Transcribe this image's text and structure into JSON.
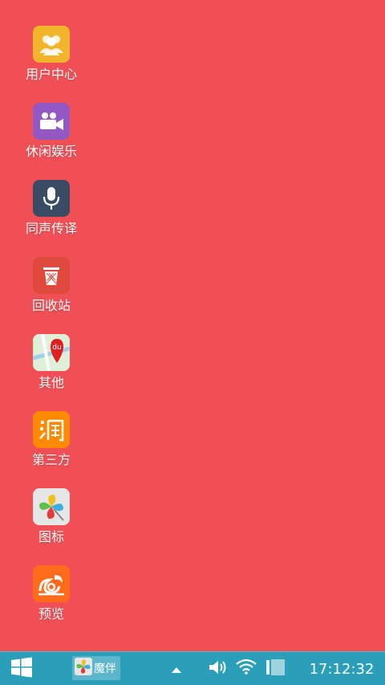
{
  "desktop": {
    "background": "#f05055",
    "icons": [
      {
        "label": "用户中心",
        "icon": "user-group-icon",
        "color": "#f2b42a"
      },
      {
        "label": "休闲娱乐",
        "icon": "video-camera-icon",
        "color": "#9358c2"
      },
      {
        "label": "同声传译",
        "icon": "microphone-icon",
        "color": "#3a4b66"
      },
      {
        "label": "回收站",
        "icon": "trash-icon",
        "color": "#e04a3e"
      },
      {
        "label": "其他",
        "icon": "map-pin-icon",
        "color": "#e8e8e8"
      },
      {
        "label": "第三方",
        "icon": "taobao-icon",
        "color": "#ff8a00"
      },
      {
        "label": "图标",
        "icon": "pinwheel-icon",
        "color": "#e6e6e6"
      },
      {
        "label": "预览",
        "icon": "uc-browser-icon",
        "color": "#ff6b1a"
      }
    ]
  },
  "taskbar": {
    "background": "#2b9fb9",
    "start_icon": "windows-start-icon",
    "running_app": {
      "label": "魔伴",
      "icon": "pinwheel-icon"
    },
    "tray": {
      "expand_icon": "chevron-up-icon",
      "volume_icon": "volume-icon",
      "wifi_icon": "wifi-icon",
      "battery_icon": "battery-icon"
    },
    "clock": "17:12:32"
  }
}
